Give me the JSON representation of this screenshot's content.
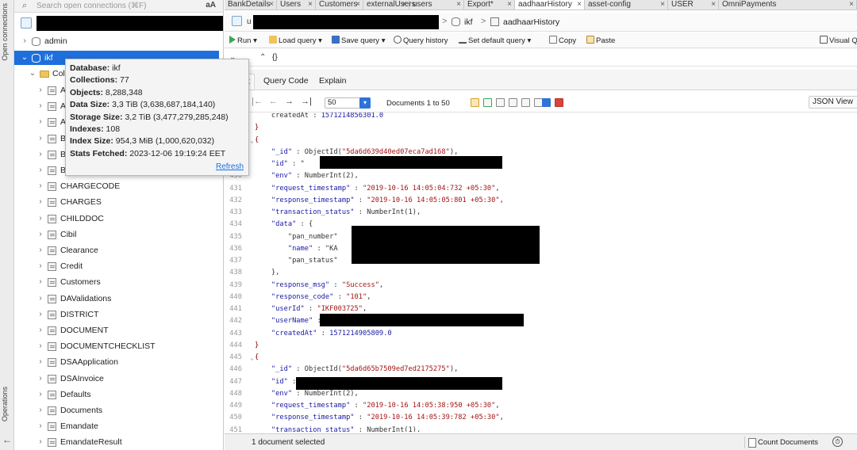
{
  "sidebar": {
    "strip_top_label": "Open connections",
    "strip_bottom_label": "Operations",
    "search_placeholder": "Search open connections (⌘F)",
    "search_case_label": "aA",
    "tree": {
      "admin_label": "admin",
      "ikf_label": "ikf",
      "collections_label": "Coll",
      "items": [
        "A",
        "A",
        "A",
        "B",
        "B",
        "B",
        "CHARGECODE",
        "CHARGES",
        "CHILDDOC",
        "Cibil",
        "Clearance",
        "Credit",
        "Customers",
        "DAValidations",
        "DISTRICT",
        "DOCUMENT",
        "DOCUMENTCHECKLIST",
        "DSAApplication",
        "DSAInvoice",
        "Defaults",
        "Documents",
        "Emandate",
        "EmandateResult"
      ]
    }
  },
  "tooltip": {
    "lines": [
      {
        "label": "Database:",
        "value": " ikf"
      },
      {
        "label": "Collections:",
        "value": " 77"
      },
      {
        "label": "Objects:",
        "value": " 8,288,348"
      },
      {
        "label": "Data Size:",
        "value": " 3,3 TiB  (3,638,687,184,140)"
      },
      {
        "label": "Storage Size:",
        "value": " 3,2 TiB  (3,477,279,285,248)"
      },
      {
        "label": "Indexes:",
        "value": " 108"
      },
      {
        "label": "Index Size:",
        "value": " 954,3 MiB  (1,000,620,032)"
      },
      {
        "label": "Stats Fetched:",
        "value": " 2023-12-06 19:19:24 EET"
      }
    ],
    "refresh_label": "Refresh"
  },
  "tabs": [
    {
      "label": "BankDetails"
    },
    {
      "label": "Users"
    },
    {
      "label": "Customers"
    },
    {
      "label": "externalUsers"
    },
    {
      "label": "users"
    },
    {
      "label": "Export*"
    },
    {
      "label": "aadhaarHistory"
    },
    {
      "label": "asset-config"
    },
    {
      "label": "USER"
    },
    {
      "label": "OmniPayments"
    }
  ],
  "pathbar": {
    "prefix": "u",
    "db": "ikf",
    "collection": "aadhaarHistory",
    "sep": ">"
  },
  "toolbar": {
    "run": "Run ▾",
    "load_query": "Load query ▾",
    "save_query": "Save query ▾",
    "query_history": "Query history",
    "set_default_query": "Set default query ▾",
    "copy": "Copy",
    "paste": "Paste",
    "visual": "Visual Q"
  },
  "querybar": {
    "query_text": "{}"
  },
  "subtabs": {
    "result": "t",
    "query_code": "Query Code",
    "explain": "Explain"
  },
  "navbar": {
    "page_size": "50",
    "documents_range": "Documents 1 to 50",
    "view_mode": "JSON View"
  },
  "code_lines": [
    {
      "ln": "",
      "text": "    createdAt : 1571214856301.0"
    },
    {
      "ln": "",
      "text": "}"
    },
    {
      "ln": "",
      "text": "{"
    },
    {
      "ln": "",
      "text": "    \"_id\" : ObjectId(\"5da6d639d40ed07eca7ad168\"),"
    },
    {
      "ln": "",
      "text": "    \"id\" : \""
    },
    {
      "ln": "430",
      "text": "    \"env\" : NumberInt(2),"
    },
    {
      "ln": "431",
      "text": "    \"request_timestamp\" : \"2019-10-16 14:05:04:732 +05:30\","
    },
    {
      "ln": "432",
      "text": "    \"response_timestamp\" : \"2019-10-16 14:05:05:801 +05:30\","
    },
    {
      "ln": "433",
      "text": "    \"transaction_status\" : NumberInt(1),"
    },
    {
      "ln": "434",
      "text": "    \"data\" : {"
    },
    {
      "ln": "435",
      "text": "        \"pan_number\""
    },
    {
      "ln": "436",
      "text": "        \"name\" : \"KA"
    },
    {
      "ln": "437",
      "text": "        \"pan_status\""
    },
    {
      "ln": "438",
      "text": "    },"
    },
    {
      "ln": "439",
      "text": "    \"response_msg\" : \"Success\","
    },
    {
      "ln": "440",
      "text": "    \"response_code\" : \"101\","
    },
    {
      "ln": "441",
      "text": "    \"userId\" : \"IKF003725\","
    },
    {
      "ln": "442",
      "text": "    \"userName\" :"
    },
    {
      "ln": "443",
      "text": "    \"createdAt\" : 1571214905809.0"
    },
    {
      "ln": "444",
      "text": "}"
    },
    {
      "ln": "445",
      "text": "{"
    },
    {
      "ln": "446",
      "text": "    \"_id\" : ObjectId(\"5da6d65b7509ed7ed2175275\"),"
    },
    {
      "ln": "447",
      "text": "    \"id\" : \""
    },
    {
      "ln": "448",
      "text": "    \"env\" : NumberInt(2),"
    },
    {
      "ln": "449",
      "text": "    \"request_timestamp\" : \"2019-10-16 14:05:38:950 +05:30\","
    },
    {
      "ln": "450",
      "text": "    \"response_timestamp\" : \"2019-10-16 14:05:39:782 +05:30\","
    },
    {
      "ln": "451",
      "text": "    \"transaction_status\" : NumberInt(1),"
    }
  ],
  "status": {
    "selected": "1 document selected",
    "count_documents": "Count Documents",
    "timer_icon": "⏱"
  },
  "colors": {
    "accent": "#1e6fdc",
    "selection": "#1e6fdc",
    "redaction": "#000000"
  }
}
